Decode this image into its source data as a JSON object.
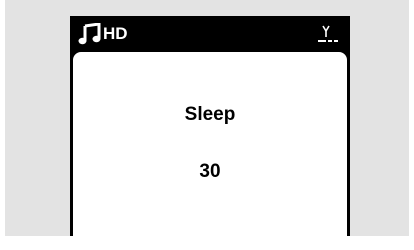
{
  "status_bar": {
    "source_icon": "music-note-icon",
    "source_label": "HD",
    "signal_icon": "antenna-signal-icon"
  },
  "screen": {
    "title": "Sleep",
    "value": "30"
  },
  "colors": {
    "frame": "#000000",
    "screen": "#ffffff",
    "panel": "#e3e3e3"
  }
}
